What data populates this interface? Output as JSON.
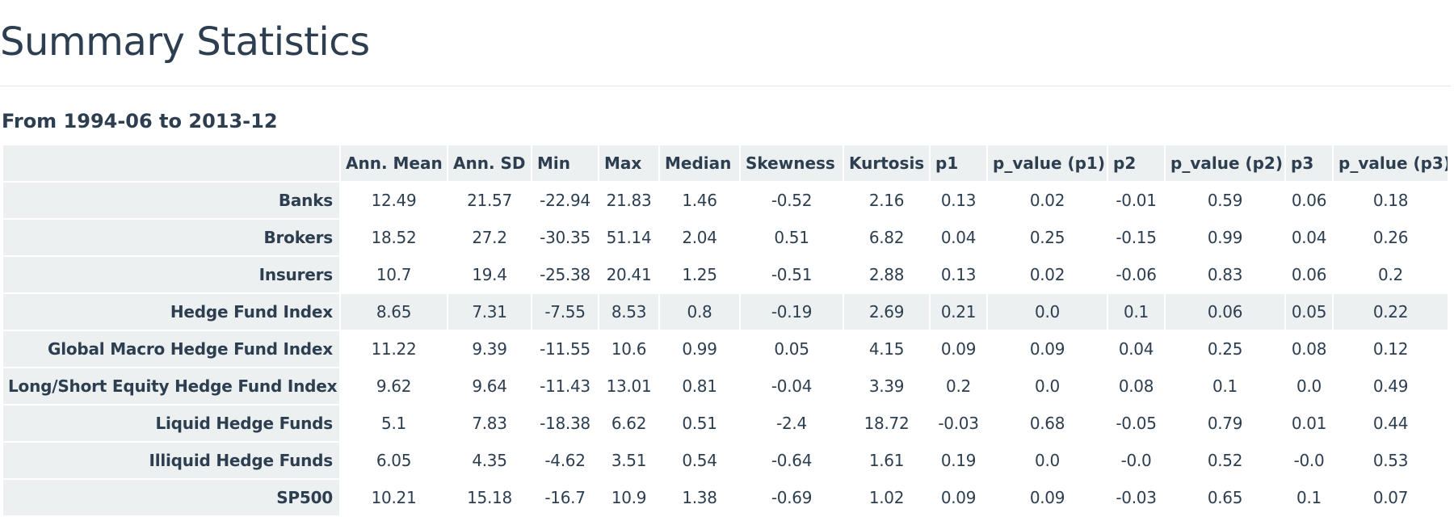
{
  "page": {
    "title": "Summary Statistics",
    "subtitle": "From 1994-06 to 2013-12"
  },
  "table": {
    "columns": [
      "",
      "Ann. Mean",
      "Ann. SD",
      "Min",
      "Max",
      "Median",
      "Skewness",
      "Kurtosis",
      "p1",
      "p_value (p1)",
      "p2",
      "p_value (p2)",
      "p3",
      "p_value (p3)"
    ],
    "highlighted_row": "Hedge Fund Index",
    "rows": [
      {
        "name": "Banks",
        "values": [
          "12.49",
          "21.57",
          "-22.94",
          "21.83",
          "1.46",
          "-0.52",
          "2.16",
          "0.13",
          "0.02",
          "-0.01",
          "0.59",
          "0.06",
          "0.18"
        ]
      },
      {
        "name": "Brokers",
        "values": [
          "18.52",
          "27.2",
          "-30.35",
          "51.14",
          "2.04",
          "0.51",
          "6.82",
          "0.04",
          "0.25",
          "-0.15",
          "0.99",
          "0.04",
          "0.26"
        ]
      },
      {
        "name": "Insurers",
        "values": [
          "10.7",
          "19.4",
          "-25.38",
          "20.41",
          "1.25",
          "-0.51",
          "2.88",
          "0.13",
          "0.02",
          "-0.06",
          "0.83",
          "0.06",
          "0.2"
        ]
      },
      {
        "name": "Hedge Fund Index",
        "values": [
          "8.65",
          "7.31",
          "-7.55",
          "8.53",
          "0.8",
          "-0.19",
          "2.69",
          "0.21",
          "0.0",
          "0.1",
          "0.06",
          "0.05",
          "0.22"
        ]
      },
      {
        "name": "Global Macro Hedge Fund Index",
        "values": [
          "11.22",
          "9.39",
          "-11.55",
          "10.6",
          "0.99",
          "0.05",
          "4.15",
          "0.09",
          "0.09",
          "0.04",
          "0.25",
          "0.08",
          "0.12"
        ]
      },
      {
        "name": "Long/Short Equity Hedge Fund Index",
        "values": [
          "9.62",
          "9.64",
          "-11.43",
          "13.01",
          "0.81",
          "-0.04",
          "3.39",
          "0.2",
          "0.0",
          "0.08",
          "0.1",
          "0.0",
          "0.49"
        ]
      },
      {
        "name": "Liquid Hedge Funds",
        "values": [
          "5.1",
          "7.83",
          "-18.38",
          "6.62",
          "0.51",
          "-2.4",
          "18.72",
          "-0.03",
          "0.68",
          "-0.05",
          "0.79",
          "0.01",
          "0.44"
        ]
      },
      {
        "name": "Illiquid Hedge Funds",
        "values": [
          "6.05",
          "4.35",
          "-4.62",
          "3.51",
          "0.54",
          "-0.64",
          "1.61",
          "0.19",
          "0.0",
          "-0.0",
          "0.52",
          "-0.0",
          "0.53"
        ]
      },
      {
        "name": "SP500",
        "values": [
          "10.21",
          "15.18",
          "-16.7",
          "10.9",
          "1.38",
          "-0.69",
          "1.02",
          "0.09",
          "0.09",
          "-0.03",
          "0.65",
          "0.1",
          "0.07"
        ]
      }
    ]
  },
  "colors": {
    "text": "#2c3e50",
    "header_bg": "#ecf0f1",
    "rule": "#e3e6e9"
  }
}
